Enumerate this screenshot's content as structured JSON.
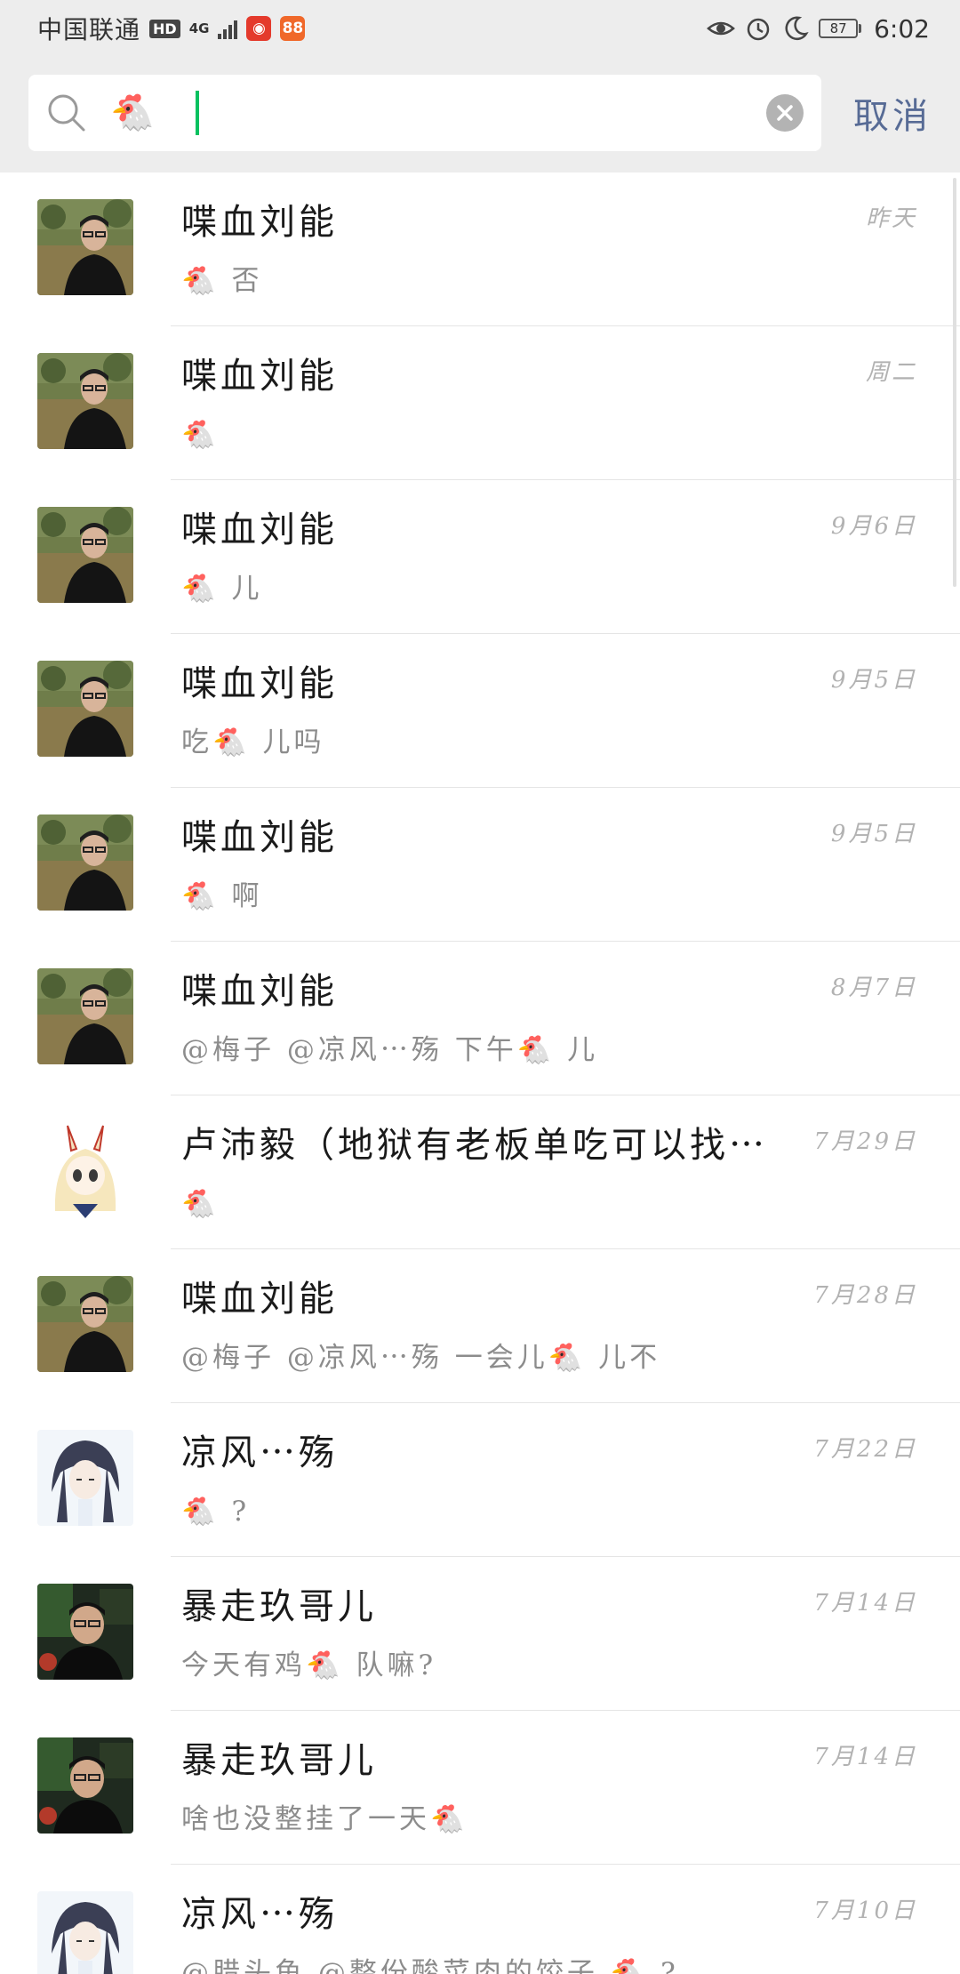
{
  "status_bar": {
    "carrier": "中国联通",
    "hd": "HD",
    "network": "4G",
    "app_icon_1": "red-app-icon",
    "app_icon_2": "orange-app-icon",
    "battery": "87",
    "battery_level": 0.87,
    "time": "6:02"
  },
  "search": {
    "query": "🐔",
    "cancel_label": "取消",
    "accent_color": "#07c160",
    "link_color": "#576b95"
  },
  "results": [
    {
      "name": "喋血刘能",
      "date": "昨天",
      "snippet": "🐔 否",
      "avatar": "man-field-photo"
    },
    {
      "name": "喋血刘能",
      "date": "周二",
      "snippet": "🐔",
      "avatar": "man-field-photo"
    },
    {
      "name": "喋血刘能",
      "date": "9月6日",
      "snippet": "🐔 儿",
      "avatar": "man-field-photo"
    },
    {
      "name": "喋血刘能",
      "date": "9月5日",
      "snippet": "吃🐔 儿吗",
      "avatar": "man-field-photo"
    },
    {
      "name": "喋血刘能",
      "date": "9月5日",
      "snippet": "🐔 啊",
      "avatar": "man-field-photo"
    },
    {
      "name": "喋血刘能",
      "date": "8月7日",
      "snippet": "@梅子 @凉风⋯殇 下午🐔 儿",
      "avatar": "man-field-photo"
    },
    {
      "name": "卢沛毅（地狱有老板单吃可以找⋯",
      "date": "7月29日",
      "snippet": "🐔",
      "avatar": "anime-girl-avatar"
    },
    {
      "name": "喋血刘能",
      "date": "7月28日",
      "snippet": "@梅子 @凉风⋯殇 一会儿🐔 儿不",
      "avatar": "man-field-photo"
    },
    {
      "name": "凉风⋯殇",
      "date": "7月22日",
      "snippet": "🐔 ?",
      "avatar": "anime-boy-avatar"
    },
    {
      "name": "暴走玖哥儿",
      "date": "7月14日",
      "snippet": "今天有鸡🐔 队嘛?",
      "avatar": "man-dark-photo"
    },
    {
      "name": "暴走玖哥儿",
      "date": "7月14日",
      "snippet": "啥也没整挂了一天🐔",
      "avatar": "man-dark-photo"
    },
    {
      "name": "凉风⋯殇",
      "date": "7月10日",
      "snippet": "@腊头鱼 @整份酸菜肉的饺子 🐔 ?",
      "avatar": "anime-boy-avatar"
    }
  ]
}
